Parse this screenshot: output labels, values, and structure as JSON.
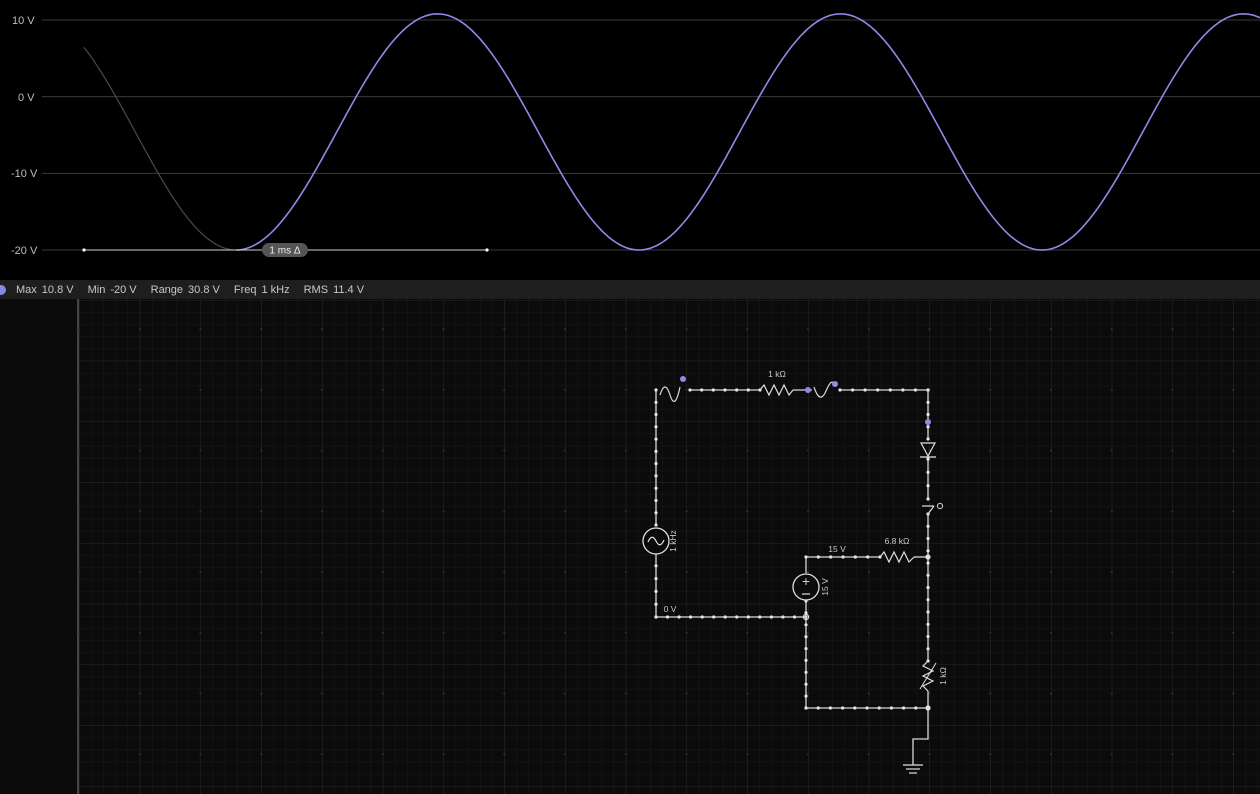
{
  "scope": {
    "y_axis_labels": [
      "10 V",
      "0 V",
      "-10 V",
      "-20 V"
    ],
    "cursor_label": "1 ms Δ",
    "trace_color": "#8f8ae8",
    "history_color": "#4a4a4a"
  },
  "chart_data": {
    "type": "line",
    "xlabel": "",
    "ylabel": "",
    "ylim": [
      -20,
      10
    ],
    "y_ticks": [
      10,
      0,
      -10,
      -20
    ],
    "grid": true,
    "series": [
      {
        "description": "clipped sine waveform, 1 kHz",
        "x_ms": [
          0,
          0.25,
          0.5,
          0.75,
          1.0,
          1.25,
          1.5,
          1.75,
          2.0,
          2.25,
          2.5,
          2.75,
          3.0
        ],
        "y": [
          -20,
          -5,
          10.8,
          -5,
          -20,
          -5,
          10.8,
          -5,
          -20,
          -5,
          10.8,
          -5,
          -20
        ]
      }
    ]
  },
  "stats": [
    {
      "key": "Max",
      "value": "10.8 V"
    },
    {
      "key": "Min",
      "value": "-20 V"
    },
    {
      "key": "Range",
      "value": "30.8 V"
    },
    {
      "key": "Freq",
      "value": "1 kHz"
    },
    {
      "key": "RMS",
      "value": "11.4 V"
    }
  ],
  "circuit": {
    "labels": {
      "r_top": "1 kΩ",
      "r_mid": "6.8 kΩ",
      "r_right": "1 kΩ",
      "source_ac": "1 kHz",
      "source_dc": "15 V",
      "node_15v": "15 V",
      "node_0v": "0 V"
    },
    "wire_color": "#d8d8d8",
    "probe_color": "#8f8ae8"
  }
}
